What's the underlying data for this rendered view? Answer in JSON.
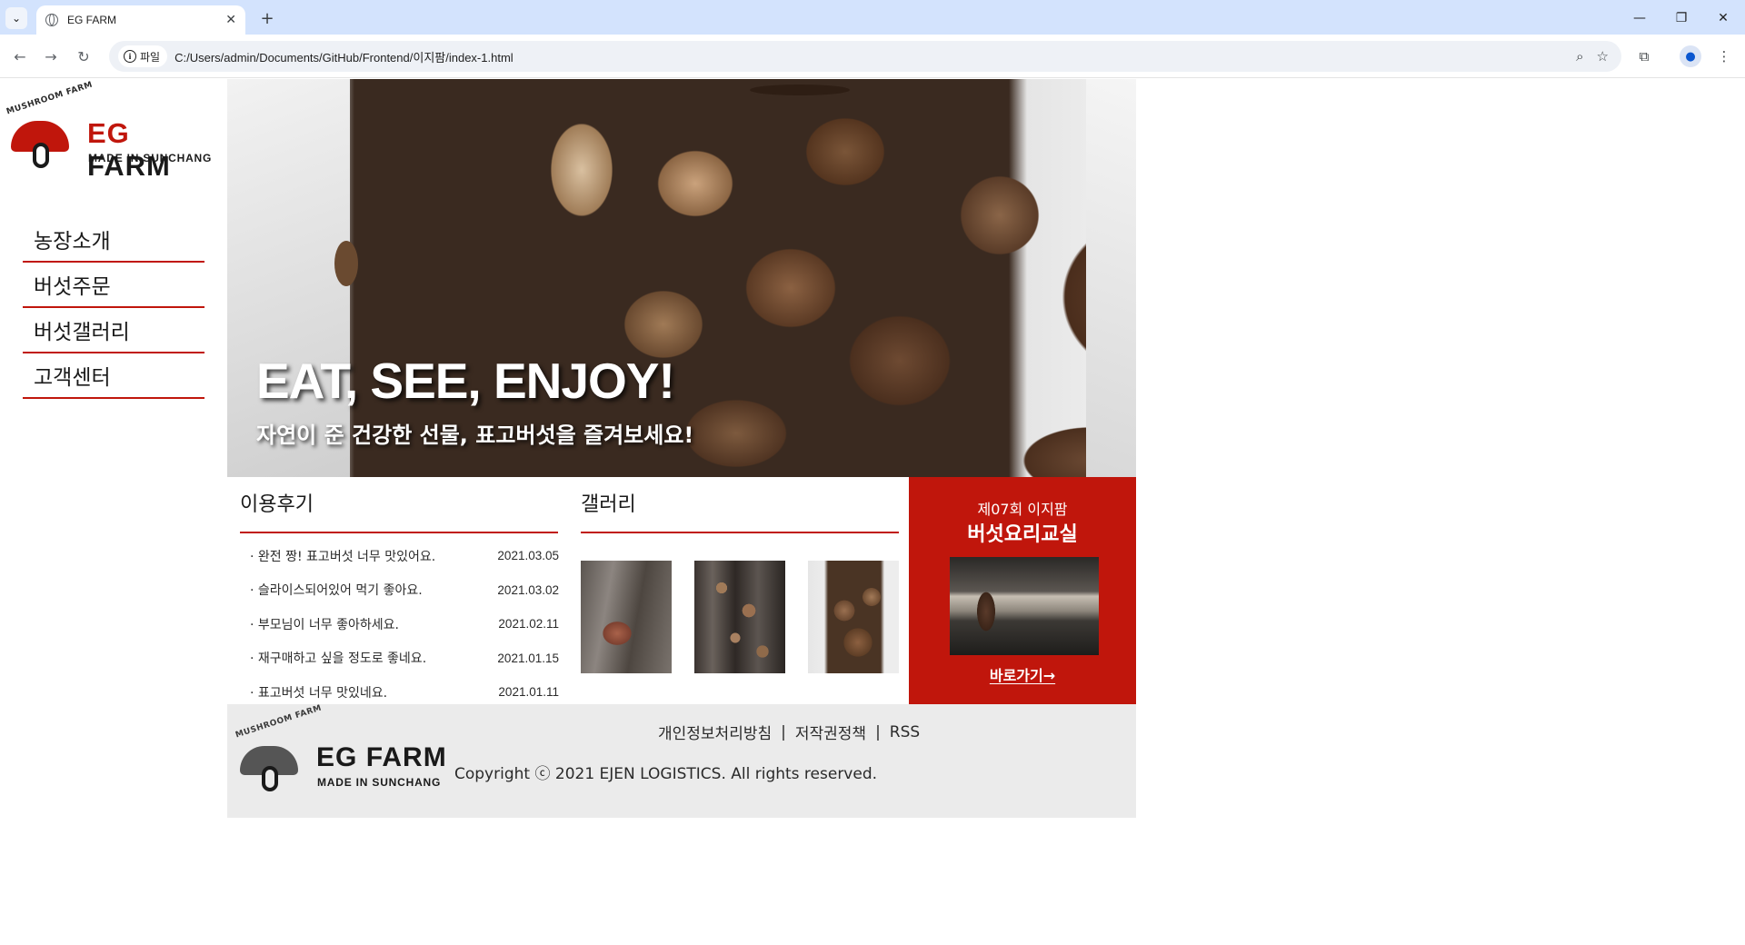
{
  "browser": {
    "tab_title": "EG FARM",
    "site_info_label": "파일",
    "url": "C:/Users/admin/Documents/GitHub/Frontend/이지팜/index-1.html"
  },
  "sidebar": {
    "logo": {
      "ring_text": "MUSHROOM FARM",
      "brand_eg": "EG",
      "brand_farm": "FARM",
      "sub": "MADE IN SUNCHANG"
    },
    "menu": [
      "농장소개",
      "버섯주문",
      "버섯갤러리",
      "고객센터"
    ]
  },
  "hero": {
    "title": "EAT, SEE, ENJOY!",
    "subtitle": "자연이 준 건강한 선물, 표고버섯을 즐겨보세요!"
  },
  "reviews": {
    "title": "이용후기",
    "items": [
      {
        "text": "· 완전 짱! 표고버섯 너무 맛있어요.",
        "date": "2021.03.05"
      },
      {
        "text": "· 슬라이스되어있어 먹기 좋아요.",
        "date": "2021.03.02"
      },
      {
        "text": "· 부모님이 너무 좋아하세요.",
        "date": "2021.02.11"
      },
      {
        "text": "· 재구매하고 싶을 정도로 좋네요.",
        "date": "2021.01.15"
      },
      {
        "text": "· 표고버섯 너무 맛있네요.",
        "date": "2021.01.11"
      }
    ]
  },
  "gallery": {
    "title": "갤러리"
  },
  "promo": {
    "edition": "제07회 이지팜",
    "title": "버섯요리교실",
    "link": "바로가기→"
  },
  "footer": {
    "links": [
      "개인정보처리방침",
      "저작권정책",
      "RSS"
    ],
    "separator": "|",
    "copyright": "Copyright ⓒ 2021 EJEN LOGISTICS. All rights reserved."
  },
  "colors": {
    "accent": "#c0160c",
    "tabbar": "#d3e3fd",
    "footer_bg": "#ebebeb"
  }
}
